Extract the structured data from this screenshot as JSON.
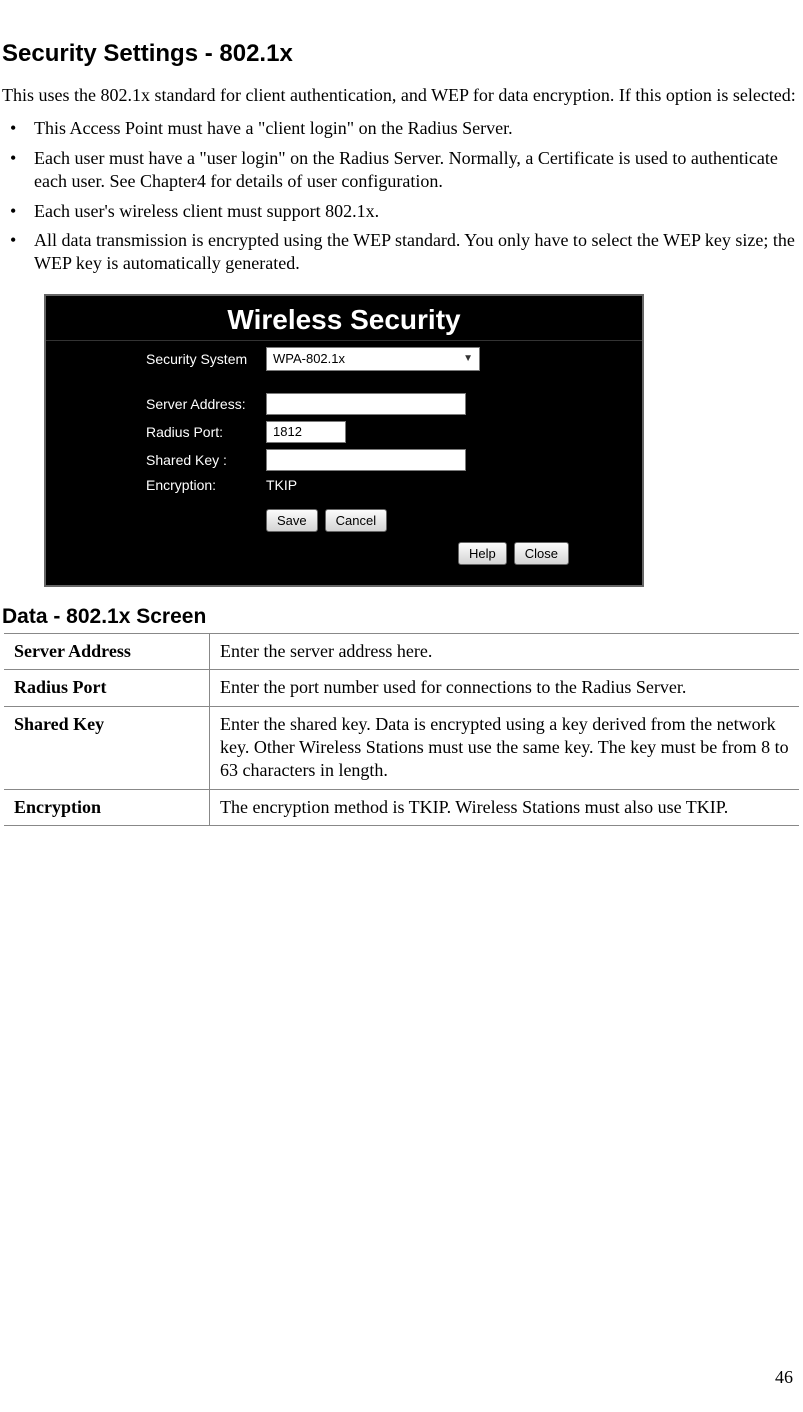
{
  "heading": "Security Settings - 802.1x",
  "intro": "This uses the 802.1x standard for client authentication, and WEP for data encryption. If this option is selected:",
  "bullets": [
    "This Access Point must have a \"client login\" on the Radius Server.",
    "Each user must have a \"user login\" on the Radius Server. Normally, a Certificate is used to authenticate each user. See Chapter4 for details of user configuration.",
    "Each user's wireless client must support 802.1x.",
    "All data transmission is encrypted using the WEP standard. You only have to select the WEP key size; the WEP key is automatically generated."
  ],
  "panel": {
    "title": "Wireless Security",
    "rows": {
      "security_system_label": "Security System",
      "security_system_value": "WPA-802.1x",
      "server_address_label": "Server Address:",
      "server_address_value": "",
      "radius_port_label": "Radius Port:",
      "radius_port_value": "1812",
      "shared_key_label": "Shared Key :",
      "shared_key_value": "",
      "encryption_label": "Encryption:",
      "encryption_value": "TKIP"
    },
    "buttons": {
      "save": "Save",
      "cancel": "Cancel",
      "help": "Help",
      "close": "Close"
    }
  },
  "table_heading": "Data - 802.1x Screen",
  "table": [
    {
      "name": "Server Address",
      "desc": "Enter the server address here."
    },
    {
      "name": "Radius Port",
      "desc": "Enter the port number used for connections to the Radius Server."
    },
    {
      "name": "Shared Key",
      "desc": "Enter the shared key. Data is encrypted using a key derived from the network key. Other Wireless Stations must use the same key. The key must be from 8 to 63 characters in length."
    },
    {
      "name": "Encryption",
      "desc": "The encryption method is TKIP. Wireless Stations must also use TKIP."
    }
  ],
  "page_number": "46"
}
